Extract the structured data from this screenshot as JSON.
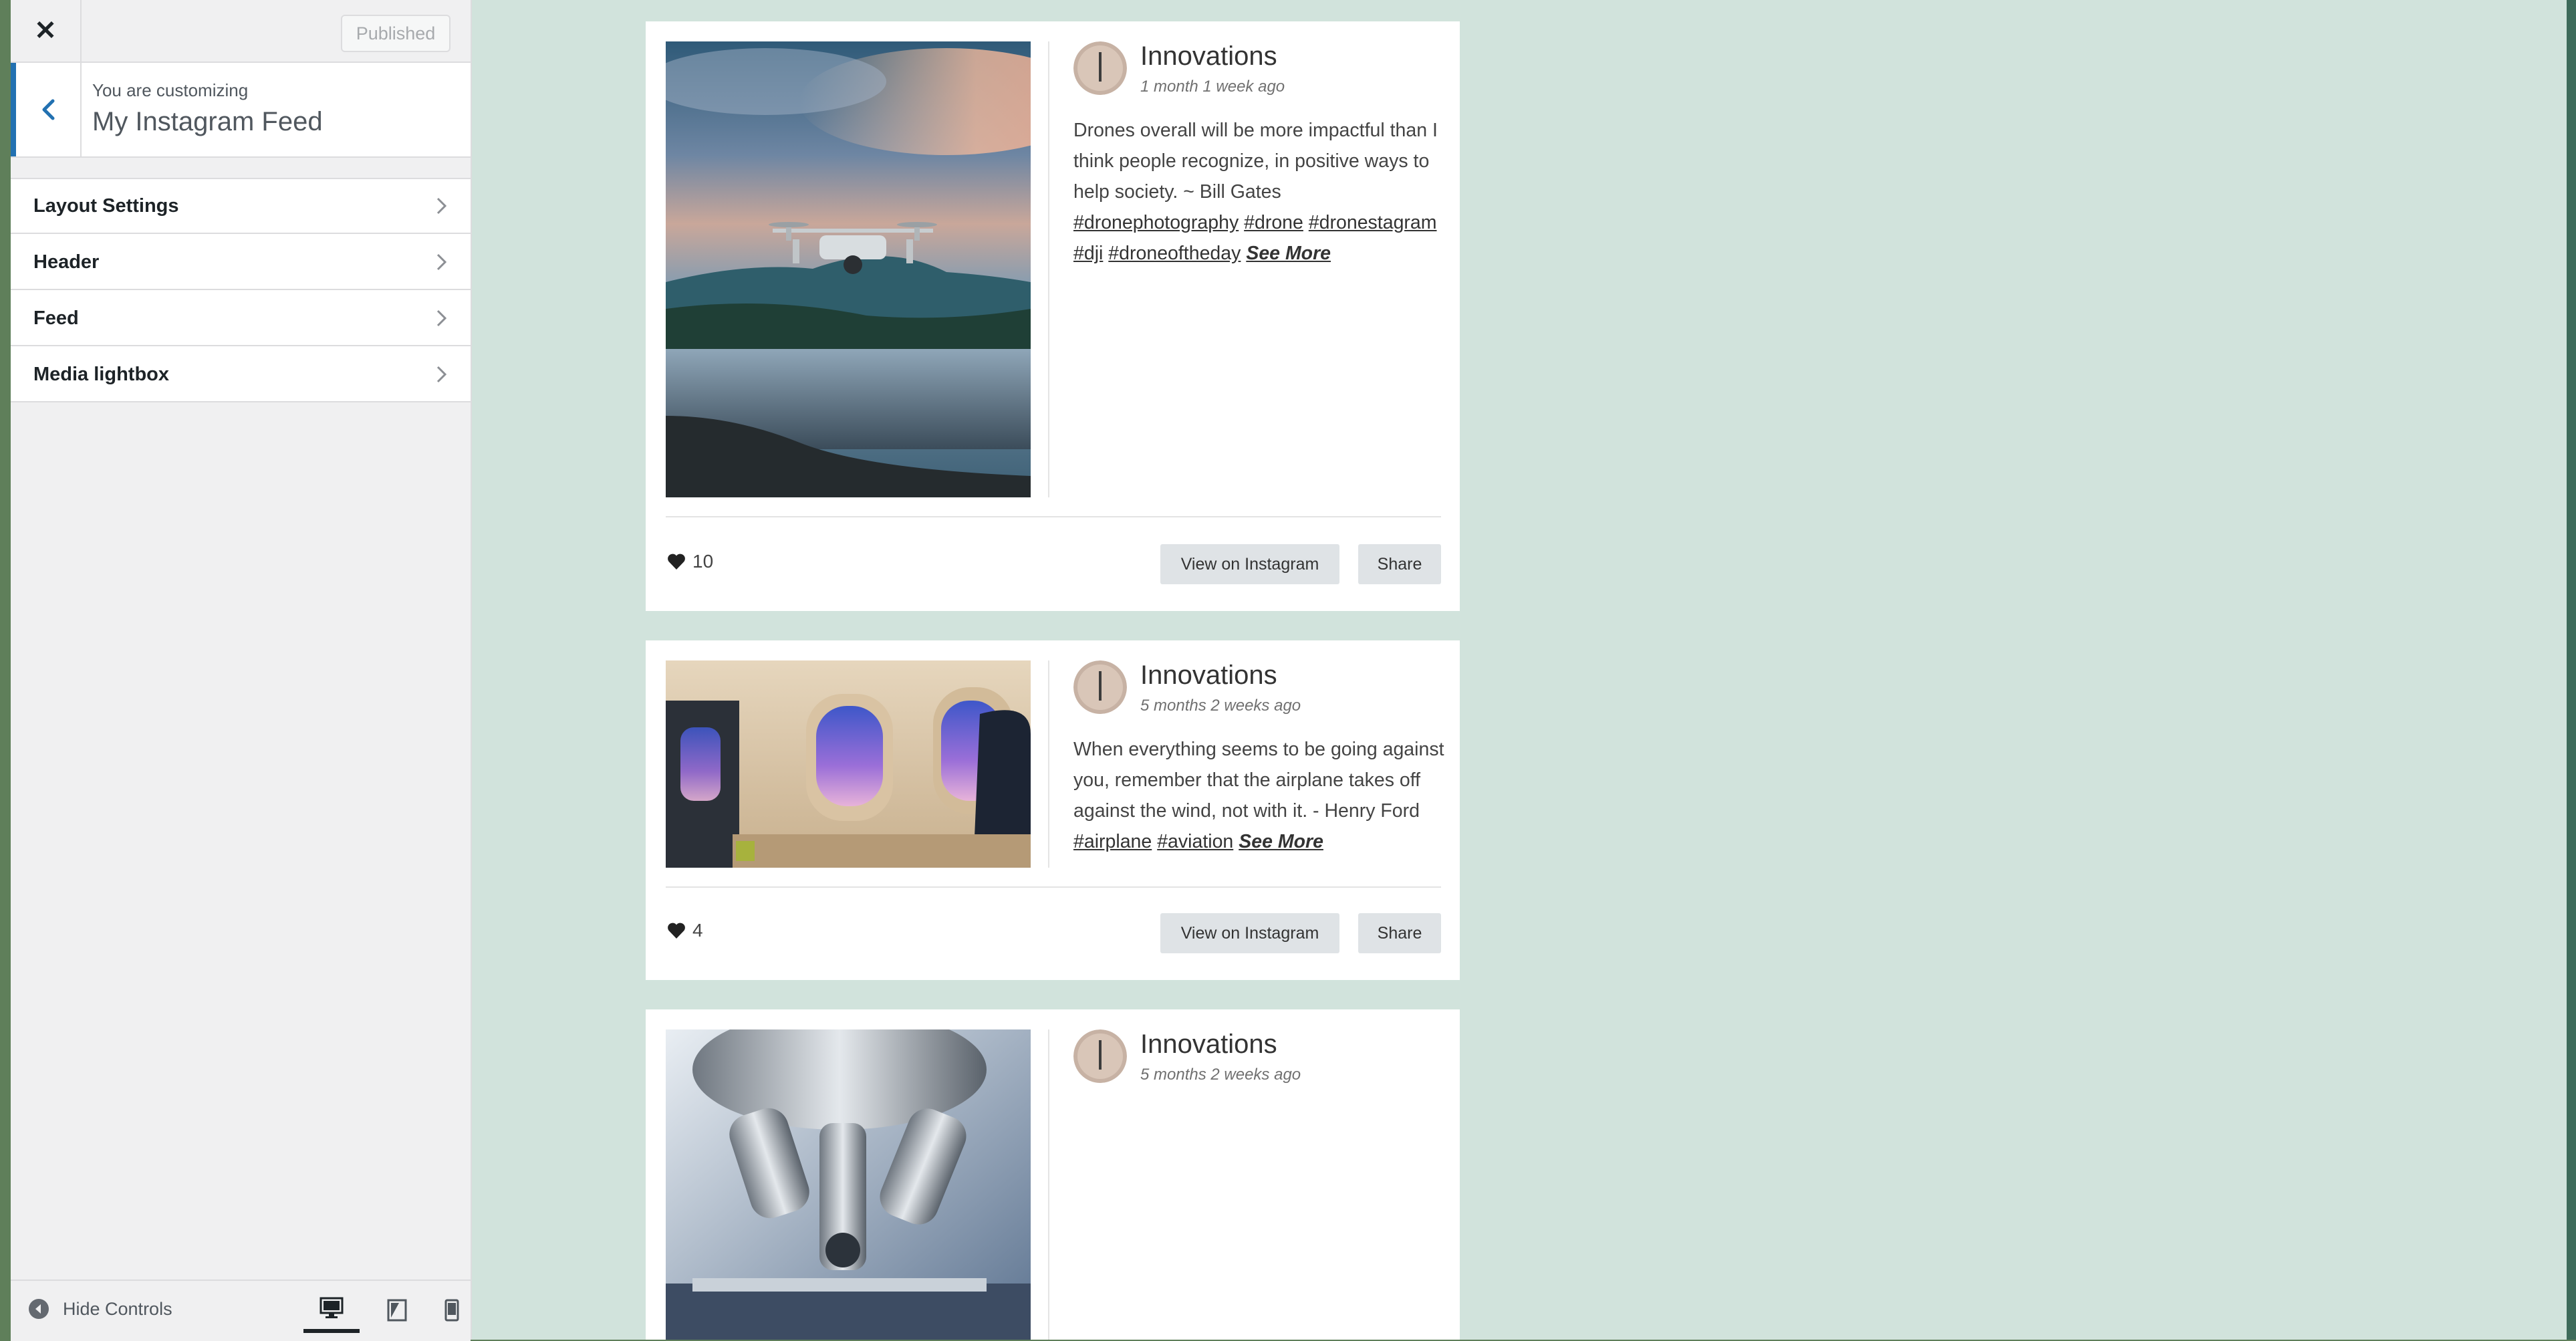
{
  "customizer": {
    "close_icon": "close-icon",
    "publish_button": "Published",
    "info": {
      "small_label": "You are customizing",
      "title": "My Instagram Feed"
    },
    "menu_items": [
      {
        "label": "Layout Settings"
      },
      {
        "label": "Header"
      },
      {
        "label": "Feed"
      },
      {
        "label": "Media lightbox"
      }
    ],
    "footer": {
      "hide_controls": "Hide Controls",
      "devices": [
        "desktop",
        "tablet",
        "mobile"
      ],
      "active_device": "desktop"
    },
    "accent_color": "#2271b1"
  },
  "feed": {
    "background": "#d1e3dc",
    "posts": [
      {
        "author": "Innovations",
        "time": "1 month 1 week ago",
        "caption_text": "Drones overall will be more impactful than I think people recognize, in positive ways to help society. ~ Bill Gates",
        "hashtags": [
          "#dronephotography",
          "#drone",
          "#dronestagram",
          "#dji",
          "#droneoftheday"
        ],
        "see_more": "See More",
        "likes": "10",
        "view_button": "View on Instagram",
        "share_button": "Share"
      },
      {
        "author": "Innovations",
        "time": "5 months 2 weeks ago",
        "caption_text": "When everything seems to be going against you, remember that the airplane takes off against the wind, not with it. - Henry Ford",
        "hashtags": [
          "#airplane",
          "#aviation"
        ],
        "see_more": "See More",
        "likes": "4",
        "view_button": "View on Instagram",
        "share_button": "Share"
      },
      {
        "author": "Innovations",
        "time": "5 months 2 weeks ago"
      }
    ]
  }
}
